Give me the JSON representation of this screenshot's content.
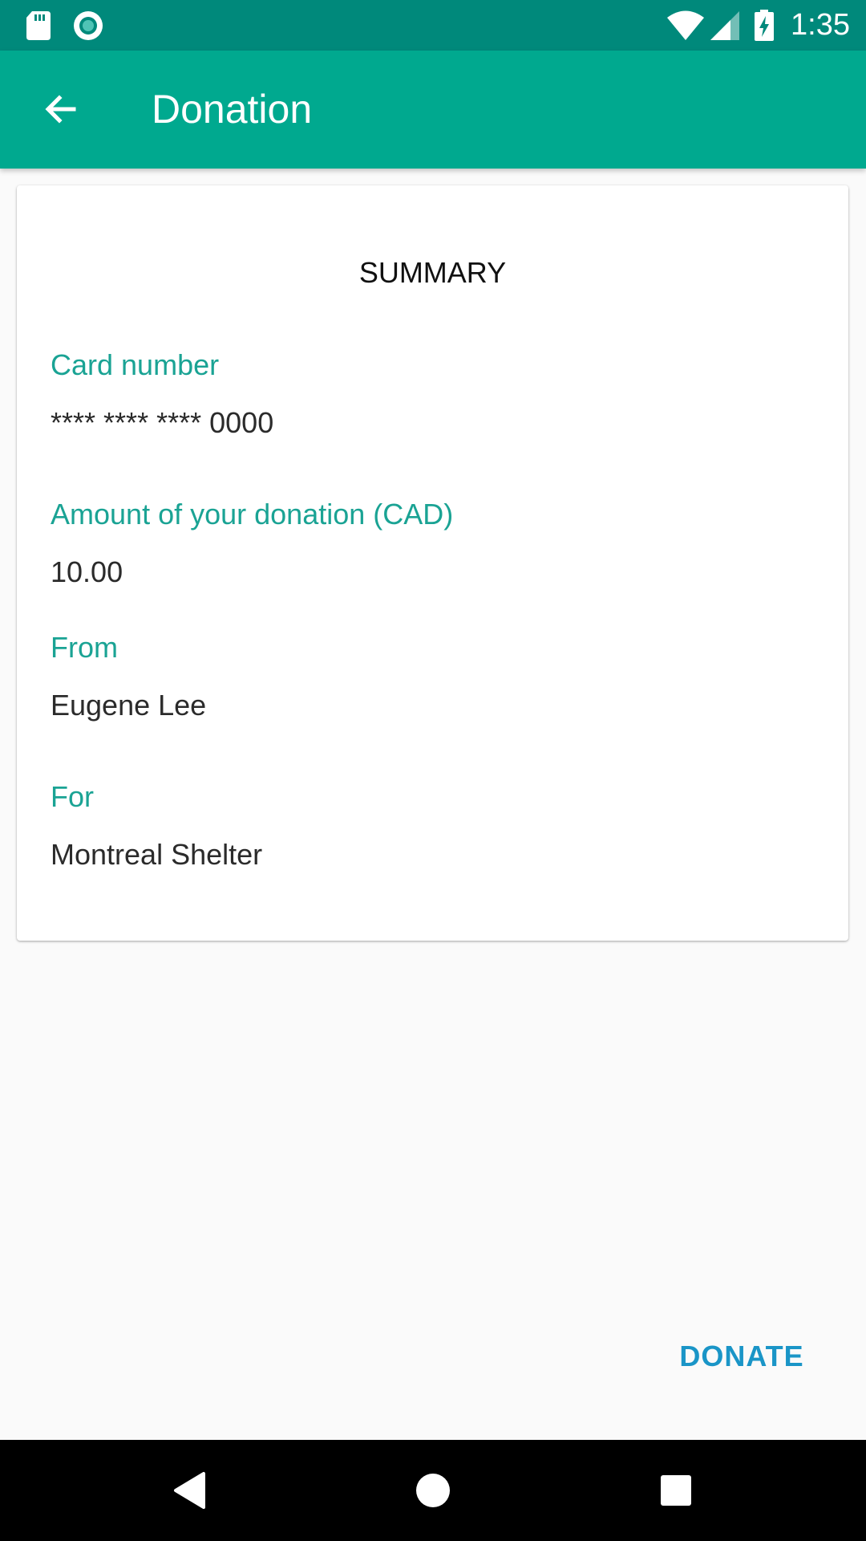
{
  "status_bar": {
    "time": "1:35",
    "icons": [
      "sd-card-icon",
      "circle-app-icon",
      "wifi-icon",
      "signal-icon",
      "battery-charging-icon"
    ]
  },
  "app_bar": {
    "title": "Donation",
    "back_icon": "arrow-back-icon"
  },
  "summary": {
    "title": "SUMMARY",
    "fields": [
      {
        "label": "Card number",
        "value": "**** **** **** 0000"
      },
      {
        "label": "Amount of your donation (CAD)",
        "value": "10.00"
      },
      {
        "label": "From",
        "value": "Eugene Lee"
      },
      {
        "label": "For",
        "value": "Montreal Shelter"
      }
    ]
  },
  "actions": {
    "donate_label": "DONATE"
  },
  "navigation": {
    "icons": [
      "back-triangle-icon",
      "home-circle-icon",
      "recents-square-icon"
    ]
  },
  "colors": {
    "status_bar": "#00897b",
    "app_bar": "#00a98f",
    "label": "#1aa394",
    "value": "#2b2b2b",
    "action": "#1a95c7",
    "background": "#fafafa",
    "card": "#ffffff"
  }
}
